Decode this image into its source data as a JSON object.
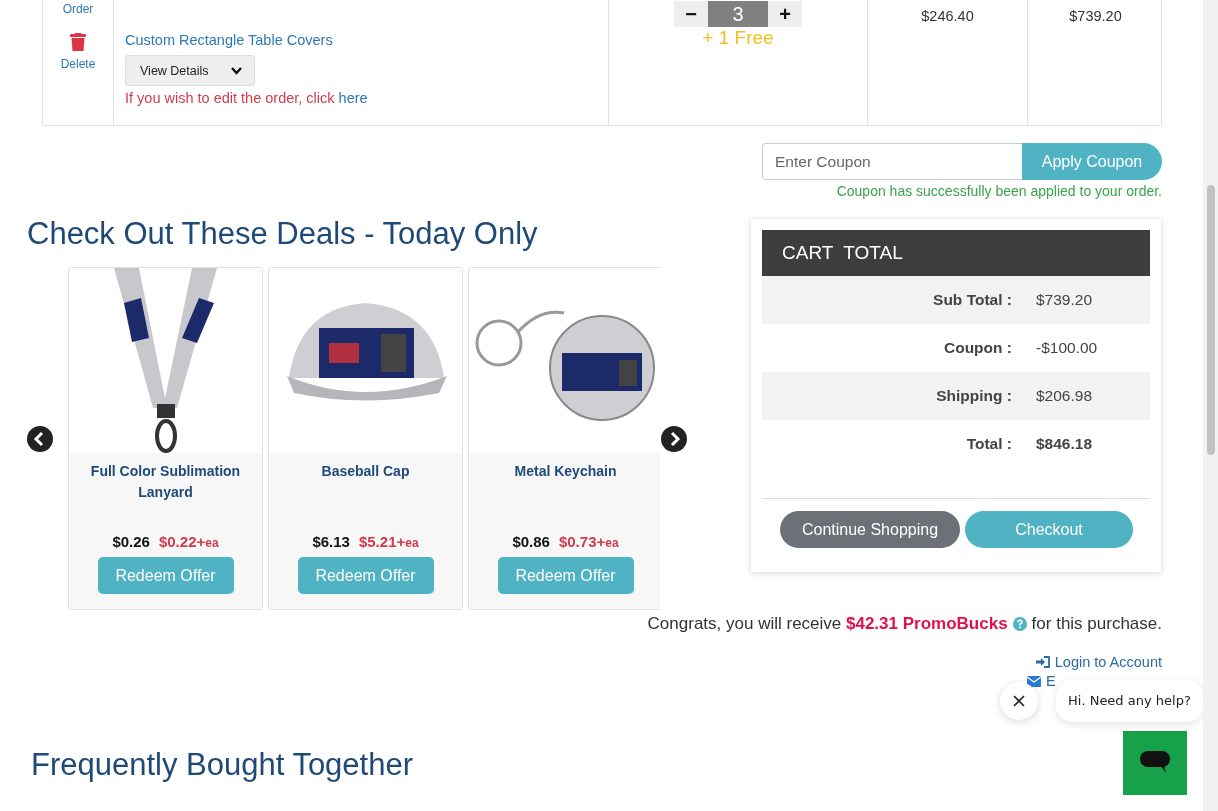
{
  "order_row": {
    "actions": [
      {
        "kind": "edit",
        "label": "Order"
      },
      {
        "kind": "delete",
        "label": "Delete"
      }
    ],
    "product": {
      "name": "Custom Rectangle Table Covers",
      "details_button": "View Details",
      "edit_note": "If you wish to edit the order, click",
      "edit_link": "here"
    },
    "quantity": {
      "decrement": "−",
      "value": "3",
      "increment": "+",
      "bonus": "+ 1 Free"
    },
    "unit_price": "$246.40",
    "total": "$739.20"
  },
  "coupon": {
    "placeholder": "Enter Coupon",
    "button": "Apply Coupon",
    "message": "Coupon has successfully been applied to your order."
  },
  "deals": {
    "title": "Check Out These Deals - Today Only",
    "items": [
      {
        "kind": "lanyard",
        "name": "Full Color Sublimation Lanyard",
        "old_price": "$0.26",
        "price": "$0.22+",
        "unit": "ea",
        "button": "Redeem Offer"
      },
      {
        "kind": "cap",
        "name": "Baseball Cap",
        "old_price": "$6.13",
        "price": "$5.21+",
        "unit": "ea",
        "button": "Redeem Offer"
      },
      {
        "kind": "keychain",
        "name": "Metal Keychain",
        "old_price": "$0.86",
        "price": "$0.73+",
        "unit": "ea",
        "button": "Redeem Offer"
      }
    ]
  },
  "cart_total": {
    "title": "CART  TOTAL",
    "rows": [
      {
        "label": "Sub Total :",
        "value": "$739.20",
        "emphasis": false
      },
      {
        "label": "Coupon :",
        "value": "-$100.00",
        "emphasis": false
      },
      {
        "label": "Shipping :",
        "value": "$206.98",
        "emphasis": false
      },
      {
        "label": "Total :",
        "value": "$846.18",
        "emphasis": true
      }
    ],
    "buttons": [
      {
        "kind": "secondary",
        "label": "Continue Shopping"
      },
      {
        "kind": "primary",
        "label": "Checkout"
      }
    ]
  },
  "promo": {
    "text": "Congrats, you will receive **$42.31 PromoBucks**",
    "after": "for this purchase."
  },
  "account_links": [
    {
      "kind": "login",
      "label": "Login to Account"
    },
    {
      "kind": "email",
      "label": "E"
    }
  ],
  "related": {
    "title": "Frequently Bought Together"
  },
  "chat": {
    "message": "Hi. Need any help?"
  }
}
